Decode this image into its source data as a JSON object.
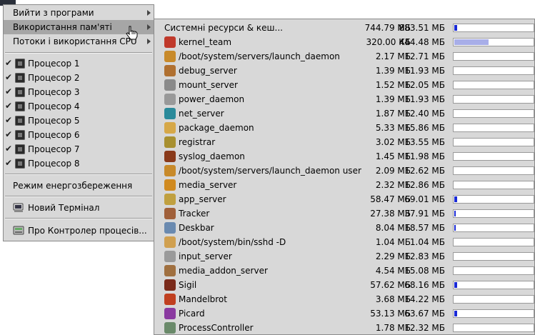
{
  "main_menu": {
    "items": [
      {
        "label": "Вийти з програми",
        "submenu": true
      },
      {
        "label": "Використання пам'яті",
        "submenu": true,
        "selected": true
      },
      {
        "label": "Потоки і використання CPU",
        "submenu": true
      }
    ],
    "processors": [
      {
        "label": "Процесор 1",
        "checked": true
      },
      {
        "label": "Процесор 2",
        "checked": true
      },
      {
        "label": "Процесор 3",
        "checked": true
      },
      {
        "label": "Процесор 4",
        "checked": true
      },
      {
        "label": "Процесор 5",
        "checked": true
      },
      {
        "label": "Процесор 6",
        "checked": true
      },
      {
        "label": "Процесор 7",
        "checked": true
      },
      {
        "label": "Процесор 8",
        "checked": true
      }
    ],
    "power_saving": "Режим енергозбереження",
    "new_terminal": "Новий Термінал",
    "about": "Про Контролер процесів..."
  },
  "memory": {
    "fill_color": "#1a2ad6",
    "kernel_fill_color": "#a8aee8",
    "rows": [
      {
        "name": "Системні ресурси & кеш...",
        "used": "744.79 МБ",
        "total": "883.51 МБ",
        "fraction": 0.04,
        "icon": "none"
      },
      {
        "name": "kernel_team",
        "used": "320.00 КБ",
        "total": "444.48 МБ",
        "fraction": 0.44,
        "icon": "kernel-icon"
      },
      {
        "name": "/boot/system/servers/launch_daemon",
        "used": "2.17 МБ",
        "total": "12.71 МБ",
        "fraction": 0.0,
        "icon": "launch-daemon-icon"
      },
      {
        "name": "debug_server",
        "used": "1.39 МБ",
        "total": "11.93 МБ",
        "fraction": 0.0,
        "icon": "debug-server-icon"
      },
      {
        "name": "mount_server",
        "used": "1.52 МБ",
        "total": "12.05 МБ",
        "fraction": 0.0,
        "icon": "mount-server-icon"
      },
      {
        "name": "power_daemon",
        "used": "1.39 МБ",
        "total": "11.93 МБ",
        "fraction": 0.0,
        "icon": "power-daemon-icon"
      },
      {
        "name": "net_server",
        "used": "1.87 МБ",
        "total": "12.40 МБ",
        "fraction": 0.0,
        "icon": "net-server-icon"
      },
      {
        "name": "package_daemon",
        "used": "5.33 МБ",
        "total": "15.86 МБ",
        "fraction": 0.0,
        "icon": "package-daemon-icon"
      },
      {
        "name": "registrar",
        "used": "3.02 МБ",
        "total": "13.55 МБ",
        "fraction": 0.0,
        "icon": "registrar-icon"
      },
      {
        "name": "syslog_daemon",
        "used": "1.45 МБ",
        "total": "11.98 МБ",
        "fraction": 0.0,
        "icon": "syslog-daemon-icon"
      },
      {
        "name": "/boot/system/servers/launch_daemon user",
        "used": "2.09 МБ",
        "total": "12.62 МБ",
        "fraction": 0.0,
        "icon": "launch-daemon-icon"
      },
      {
        "name": "media_server",
        "used": "2.32 МБ",
        "total": "12.86 МБ",
        "fraction": 0.0,
        "icon": "media-server-icon"
      },
      {
        "name": "app_server",
        "used": "58.47 МБ",
        "total": "69.01 МБ",
        "fraction": 0.04,
        "icon": "app-server-icon"
      },
      {
        "name": "Tracker",
        "used": "27.38 МБ",
        "total": "37.91 МБ",
        "fraction": 0.02,
        "icon": "tracker-icon"
      },
      {
        "name": "Deskbar",
        "used": "8.04 МБ",
        "total": "18.57 МБ",
        "fraction": 0.01,
        "icon": "deskbar-icon"
      },
      {
        "name": "/boot/system/bin/sshd -D",
        "used": "1.04 МБ",
        "total": "1.04 МБ",
        "fraction": 0.0,
        "icon": "sshd-icon"
      },
      {
        "name": "input_server",
        "used": "2.29 МБ",
        "total": "12.83 МБ",
        "fraction": 0.0,
        "icon": "input-server-icon"
      },
      {
        "name": "media_addon_server",
        "used": "4.54 МБ",
        "total": "15.08 МБ",
        "fraction": 0.0,
        "icon": "media-addon-server-icon"
      },
      {
        "name": "Sigil",
        "used": "57.62 МБ",
        "total": "68.16 МБ",
        "fraction": 0.04,
        "icon": "sigil-icon"
      },
      {
        "name": "Mandelbrot",
        "used": "3.68 МБ",
        "total": "14.22 МБ",
        "fraction": 0.0,
        "icon": "mandelbrot-icon"
      },
      {
        "name": "Picard",
        "used": "53.13 МБ",
        "total": "63.67 МБ",
        "fraction": 0.04,
        "icon": "picard-icon"
      },
      {
        "name": "ProcessController",
        "used": "1.78 МБ",
        "total": "12.32 МБ",
        "fraction": 0.0,
        "icon": "process-controller-icon"
      }
    ]
  }
}
